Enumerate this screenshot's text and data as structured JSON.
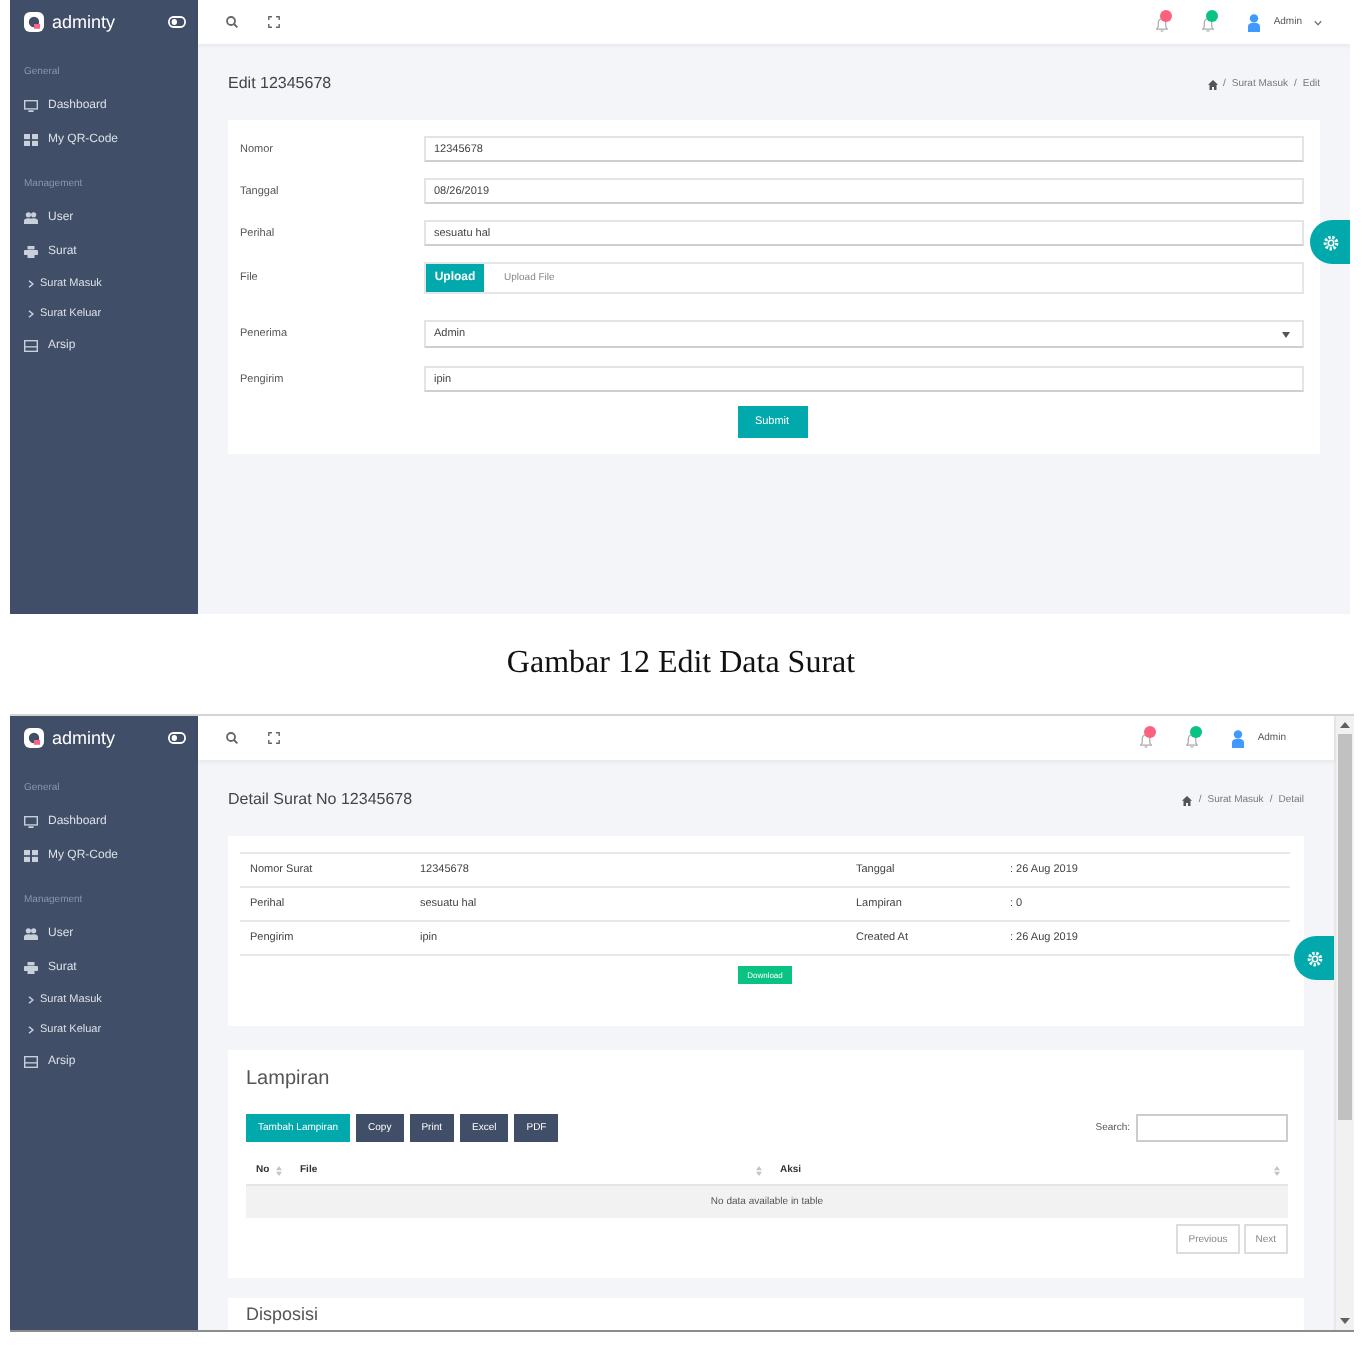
{
  "edit_screen": {
    "sidebar": {
      "logo": "adminty",
      "sections": [
        {
          "title": "General",
          "items": [
            {
              "label": "Dashboard"
            },
            {
              "label": "My QR-Code"
            }
          ]
        },
        {
          "title": "Management",
          "items": [
            {
              "label": "User"
            },
            {
              "label": "Surat",
              "children": [
                {
                  "label": "Surat Masuk"
                },
                {
                  "label": "Surat Keluar"
                }
              ]
            },
            {
              "label": "Arsip"
            }
          ]
        }
      ]
    },
    "header": {
      "notifications": [
        {
          "color": "#fc6180"
        },
        {
          "color": "#0ac282"
        }
      ],
      "user": "Admin",
      "dropdown_caret": true
    },
    "title": "Edit 12345678",
    "breadcrumb": {
      "separator": "/",
      "items": [
        "Surat Masuk",
        "Edit"
      ]
    },
    "form": {
      "fields": [
        {
          "kind": "text",
          "label": "Nomor",
          "value": "12345678"
        },
        {
          "kind": "text",
          "label": "Tanggal",
          "value": "08/26/2019"
        },
        {
          "kind": "text",
          "label": "Perihal",
          "value": "sesuatu hal"
        },
        {
          "kind": "file",
          "label": "File",
          "button": "Upload",
          "placeholder": "Upload File"
        },
        {
          "kind": "select",
          "label": "Penerima",
          "value": "Admin"
        },
        {
          "kind": "text",
          "label": "Pengirim",
          "value": "ipin"
        }
      ],
      "submit": "Submit"
    }
  },
  "caption": "Gambar 12 Edit Data Surat",
  "detail_screen": {
    "sidebar": {
      "logo": "adminty",
      "sections": [
        {
          "title": "General",
          "items": [
            {
              "label": "Dashboard"
            },
            {
              "label": "My QR-Code"
            }
          ]
        },
        {
          "title": "Management",
          "items": [
            {
              "label": "User"
            },
            {
              "label": "Surat",
              "children": [
                {
                  "label": "Surat Masuk"
                },
                {
                  "label": "Surat Keluar"
                }
              ]
            },
            {
              "label": "Arsip"
            }
          ]
        }
      ]
    },
    "header": {
      "notifications": [
        {
          "color": "#fc6180"
        },
        {
          "color": "#0ac282"
        }
      ],
      "user": "Admin"
    },
    "title": "Detail Surat No 12345678",
    "breadcrumb": {
      "separator": "/",
      "items": [
        "Surat Masuk",
        "Detail"
      ]
    },
    "details": {
      "rows": [
        [
          {
            "label": "Nomor Surat",
            "value": "12345678"
          },
          {
            "label": "Tanggal",
            "value": ": 26 Aug 2019"
          }
        ],
        [
          {
            "label": "Perihal",
            "value": "sesuatu hal"
          },
          {
            "label": "Lampiran",
            "value": ": 0"
          }
        ],
        [
          {
            "label": "Pengirim",
            "value": "ipin"
          },
          {
            "label": "Created At",
            "value": ": 26 Aug 2019"
          }
        ]
      ],
      "download": "Download"
    },
    "attachments": {
      "title": "Lampiran",
      "buttons": [
        {
          "kind": "primary",
          "label": "Tambah Lampiran"
        },
        {
          "kind": "export",
          "label": "Copy"
        },
        {
          "kind": "export",
          "label": "Print"
        },
        {
          "kind": "export",
          "label": "Excel"
        },
        {
          "kind": "export",
          "label": "PDF"
        }
      ],
      "search_label": "Search:",
      "columns": [
        "No",
        "File",
        "Aksi"
      ],
      "empty_message": "No data available in table",
      "pagination": [
        "Previous",
        "Next"
      ]
    },
    "disposition": {
      "title": "Disposisi"
    }
  }
}
